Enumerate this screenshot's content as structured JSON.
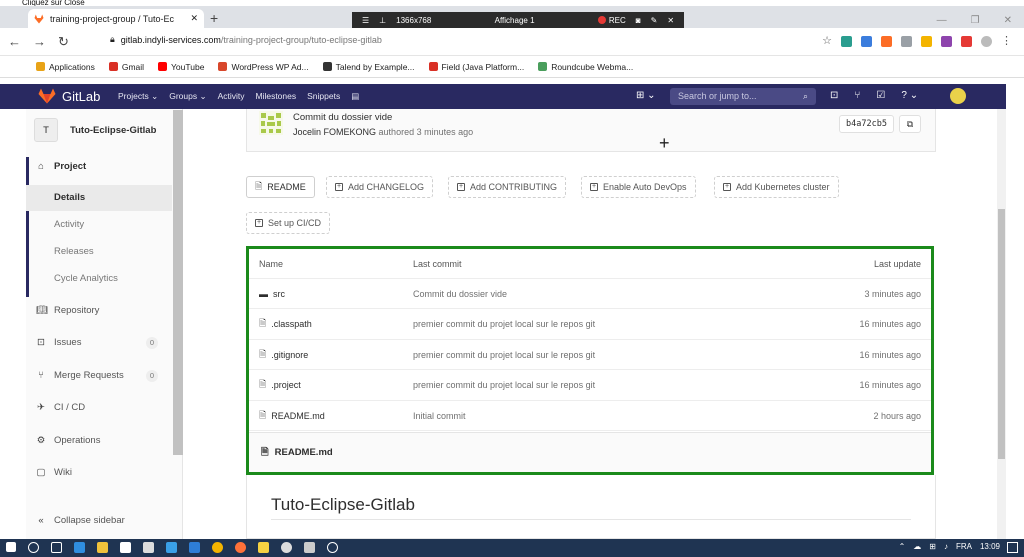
{
  "caption": "Cliquez sur Close",
  "browser": {
    "tab_title": "training-project-group / Tuto-Ec",
    "recorder": {
      "resolution": "1366x768",
      "display": "Affichage 1",
      "rec": "REC"
    },
    "url_host": "gitlab.indyli-services.com",
    "url_path": "/training-project-group/tuto-eclipse-gitlab",
    "bookmarks": [
      "Applications",
      "Gmail",
      "YouTube",
      "WordPress WP Ad...",
      "Talend by Example...",
      "Field (Java Platform...",
      "Roundcube Webma..."
    ],
    "bookmark_colors": [
      "#e8a317",
      "#d93025",
      "#ff0000",
      "#d8472b",
      "#333333",
      "#d93025",
      "#4a9e5c"
    ]
  },
  "gitlab_nav": {
    "brand": "GitLab",
    "menu": [
      "Projects ⌄",
      "Groups ⌄",
      "Activity",
      "Milestones",
      "Snippets"
    ],
    "search_placeholder": "Search or jump to...",
    "colors": {
      "nav_bg": "#292961",
      "accent": "#fc6d26"
    }
  },
  "sidebar": {
    "project_initial": "T",
    "project_name": "Tuto-Eclipse-Gitlab",
    "project_label": "Project",
    "sub_items": [
      "Details",
      "Activity",
      "Releases",
      "Cycle Analytics"
    ],
    "items": [
      {
        "label": "Repository"
      },
      {
        "label": "Issues",
        "count": "0"
      },
      {
        "label": "Merge Requests",
        "count": "0"
      },
      {
        "label": "CI / CD"
      },
      {
        "label": "Operations"
      },
      {
        "label": "Wiki"
      }
    ],
    "collapse": "Collapse sidebar"
  },
  "commit": {
    "title": "Commit du dossier vide",
    "author": "Jocelin FOMEKONG",
    "authored": "authored 3 minutes ago",
    "sha": "b4a72cb5"
  },
  "actions": {
    "readme": "README",
    "add_changelog": "Add CHANGELOG",
    "add_contributing": "Add CONTRIBUTING",
    "auto_devops": "Enable Auto DevOps",
    "add_k8s": "Add Kubernetes cluster",
    "setup_cicd": "Set up CI/CD"
  },
  "files": {
    "headers": {
      "name": "Name",
      "last_commit": "Last commit",
      "last_update": "Last update"
    },
    "rows": [
      {
        "name": "src",
        "type": "folder",
        "commit": "Commit du dossier vide",
        "updated": "3 minutes ago"
      },
      {
        "name": ".classpath",
        "type": "file",
        "commit": "premier commit du projet local sur le repos git",
        "updated": "16 minutes ago"
      },
      {
        "name": ".gitignore",
        "type": "file",
        "commit": "premier commit du projet local sur le repos git",
        "updated": "16 minutes ago"
      },
      {
        "name": ".project",
        "type": "file",
        "commit": "premier commit du projet local sur le repos git",
        "updated": "16 minutes ago"
      },
      {
        "name": "README.md",
        "type": "file",
        "commit": "Initial commit",
        "updated": "2 hours ago"
      }
    ],
    "readme_file": "README.md"
  },
  "readme": {
    "heading": "Tuto-Eclipse-Gitlab"
  },
  "taskbar": {
    "language": "FRA",
    "time": "13:09"
  }
}
